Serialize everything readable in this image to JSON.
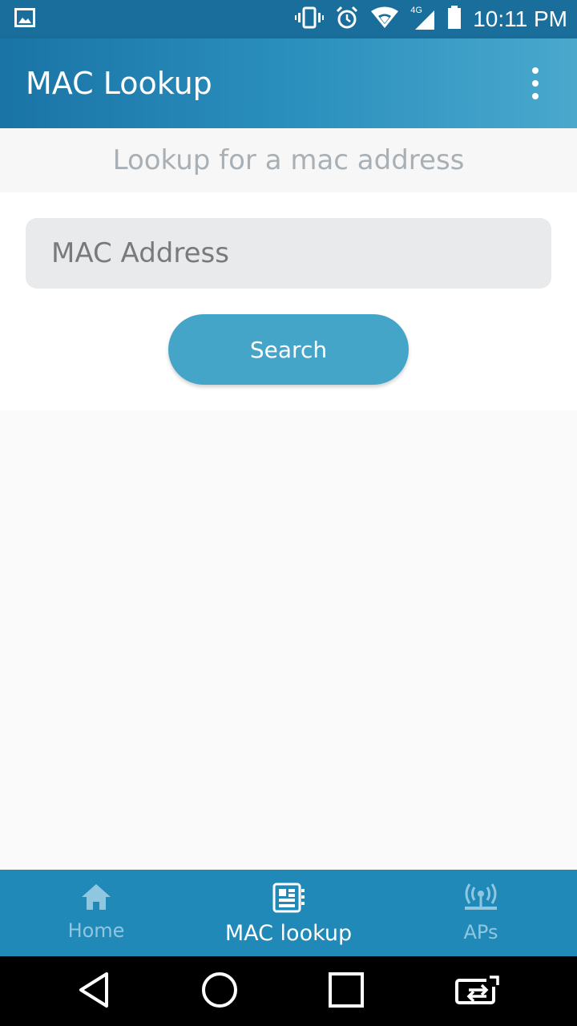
{
  "status_bar": {
    "time": "10:11 PM",
    "icons": [
      "image-icon",
      "vibrate-icon",
      "alarm-icon",
      "wifi-icon",
      "signal-4g-icon",
      "battery-icon"
    ],
    "network_label": "4G"
  },
  "app_bar": {
    "title": "MAC Lookup",
    "menu_icon": "more-vert-icon"
  },
  "page": {
    "subtitle": "Lookup for a mac address"
  },
  "form": {
    "mac_placeholder": "MAC Address",
    "mac_value": "",
    "search_label": "Search"
  },
  "bottom_nav": {
    "items": [
      {
        "label": "Home",
        "icon": "home-icon",
        "active": false
      },
      {
        "label": "MAC lookup",
        "icon": "mac-lookup-icon",
        "active": true
      },
      {
        "label": "APs",
        "icon": "access-point-icon",
        "active": false
      }
    ]
  },
  "system_nav": {
    "icons": [
      "back-icon",
      "home-circle-icon",
      "recents-icon",
      "switch-app-icon"
    ]
  },
  "colors": {
    "app_bar": "#1a74a6",
    "accent": "#45a5c9",
    "bottom_nav": "#2189b8",
    "inactive_nav": "#8fc6e0"
  }
}
